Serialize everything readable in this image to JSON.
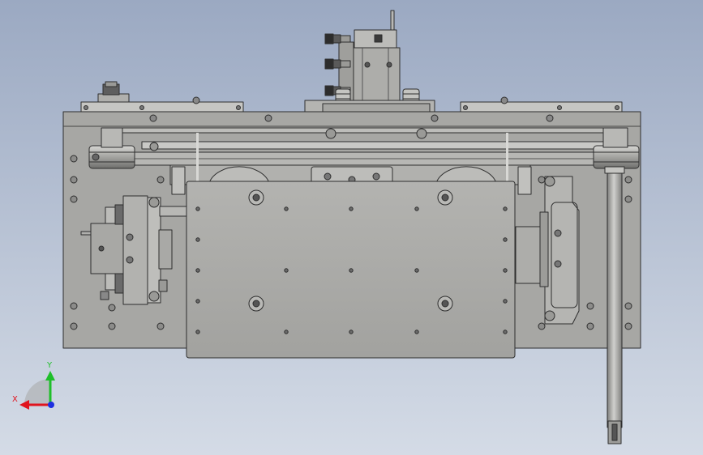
{
  "model": {
    "name": "",
    "view": "front"
  },
  "triad": {
    "x_label": "X",
    "y_label": "Y",
    "x_color": "#e0141e",
    "y_color": "#1fbf2a",
    "z_color": "#1d2fe0"
  },
  "colors": {
    "background_top": "#9ba9c2",
    "background_bottom": "#d4dbe6",
    "metal": "#a9a9a6",
    "metal_light": "#bebebb",
    "metal_dark": "#8e8e8b",
    "outline": "#2e2e2e"
  }
}
